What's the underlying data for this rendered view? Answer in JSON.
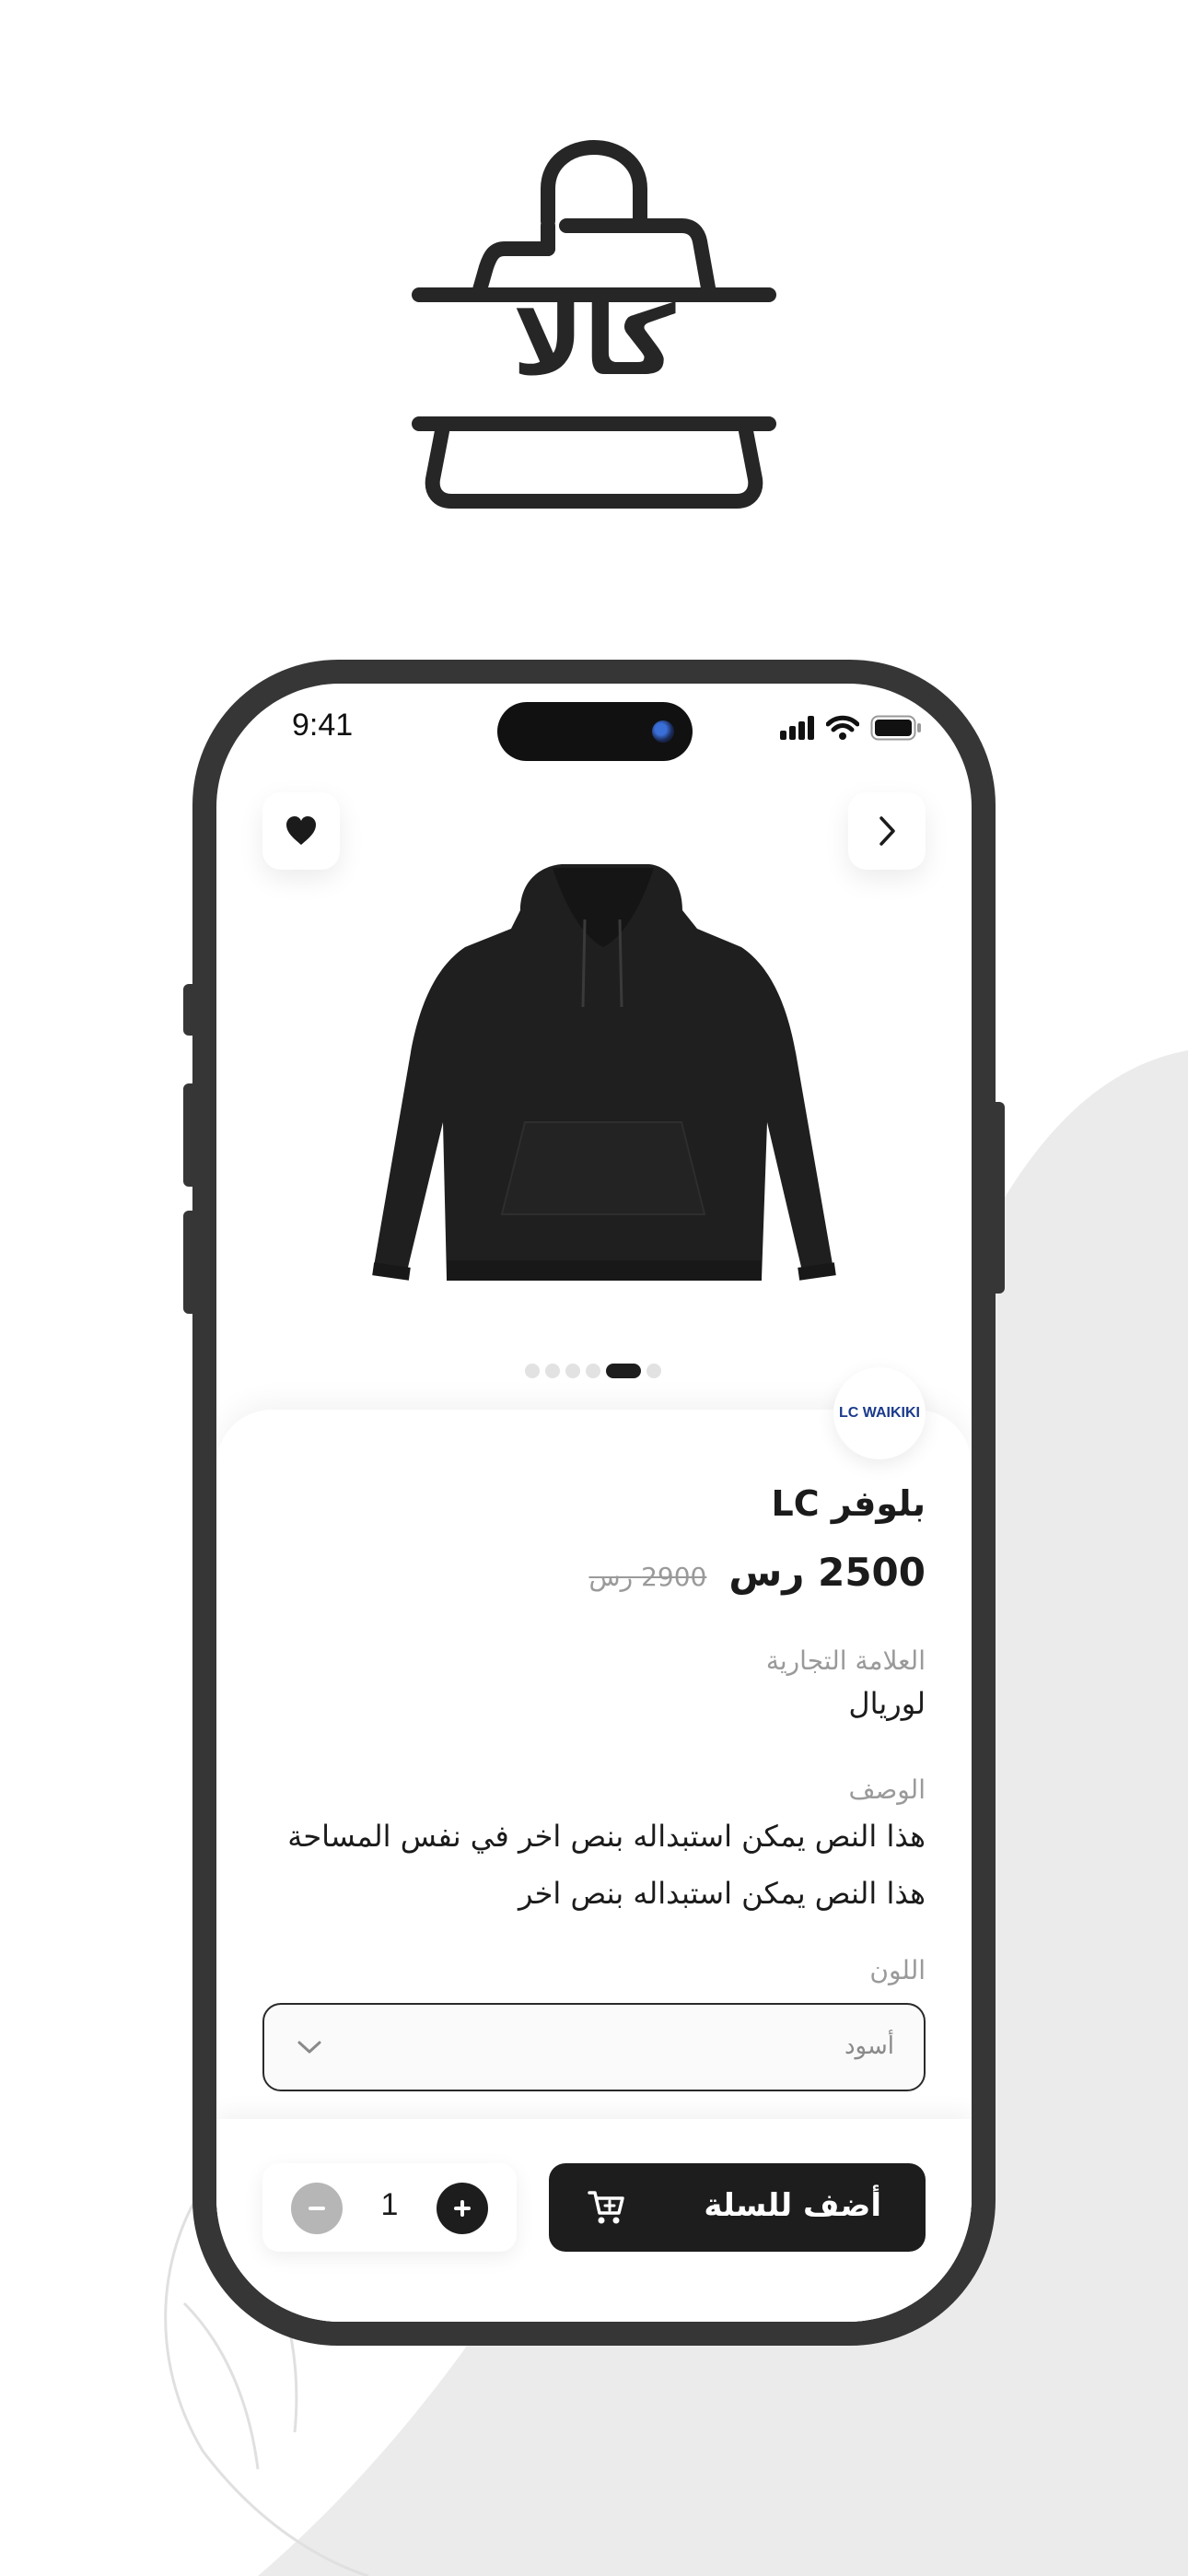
{
  "app": {
    "logo_text": "كالا"
  },
  "status_bar": {
    "time": "9:41"
  },
  "top_actions": {
    "favorite_icon": "heart-icon",
    "next_icon": "chevron-right-icon"
  },
  "gallery": {
    "total_images": 6,
    "active_index": 4
  },
  "product": {
    "brand_logo_text": "LC WAIKIKI",
    "title": "بلوفر LC",
    "price": "2500 رس",
    "old_price": "2900 رس",
    "brand_label": "العلامة التجارية",
    "brand_value": "لوريال",
    "description_label": "الوصف",
    "description_line1": "هذا النص يمكن استبداله بنص اخر في نفس المساحة",
    "description_line2": "هذا النص يمكن استبداله بنص اخر",
    "color_label": "اللون",
    "color_value": "أسود"
  },
  "cart": {
    "quantity": "1",
    "add_label": "أضف للسلة"
  },
  "colors": {
    "primary": "#1d1d1d",
    "frame": "#363636",
    "muted": "#9a9a9a",
    "background_shape": "#ebebeb"
  }
}
